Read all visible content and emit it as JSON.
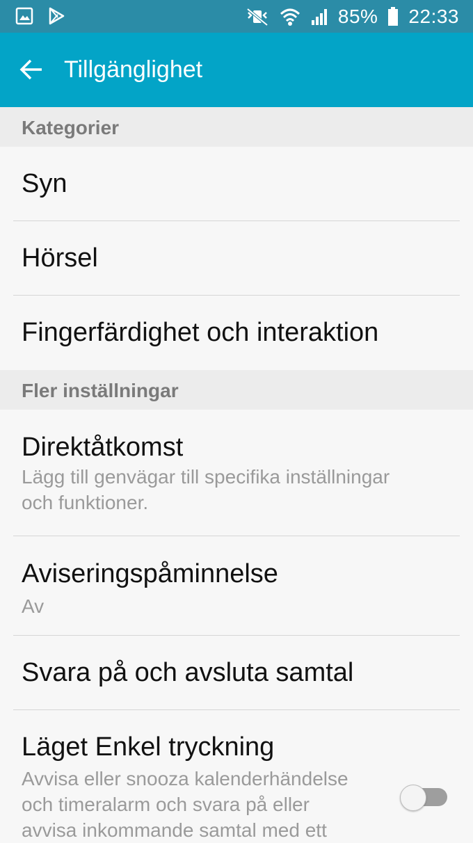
{
  "status_bar": {
    "battery_percent": "85%",
    "time": "22:33",
    "icons": [
      "gallery-icon",
      "play-store-icon",
      "mute-icon",
      "wifi-icon",
      "signal-icon",
      "battery-icon"
    ]
  },
  "app_bar": {
    "title": "Tillgänglighet",
    "back_icon": "arrow-left-icon"
  },
  "sections": {
    "categories": {
      "header": "Kategorier",
      "items": [
        {
          "title": "Syn"
        },
        {
          "title": "Hörsel"
        },
        {
          "title": "Fingerfärdighet och interaktion"
        }
      ]
    },
    "more_settings": {
      "header": "Fler inställningar",
      "items": [
        {
          "title": "Direktåtkomst",
          "sub1": "Lägg till genvägar till specifika inställningar",
          "sub2": "och funktioner."
        },
        {
          "title": "Aviseringspåminnelse",
          "sub1": "Av"
        },
        {
          "title": "Svara på och avsluta samtal"
        },
        {
          "title": "Läget Enkel tryckning",
          "sub1": "Avvisa eller snooza kalenderhändelse",
          "sub2": "och timeralarm och svara på eller",
          "sub3": "avvisa inkommande samtal med ett",
          "toggle_on": false
        }
      ]
    }
  },
  "colors": {
    "status_bar": "#2b8ca7",
    "app_bar": "#03a4c7",
    "section_header_bg": "#ececec",
    "background": "#f7f7f7"
  }
}
